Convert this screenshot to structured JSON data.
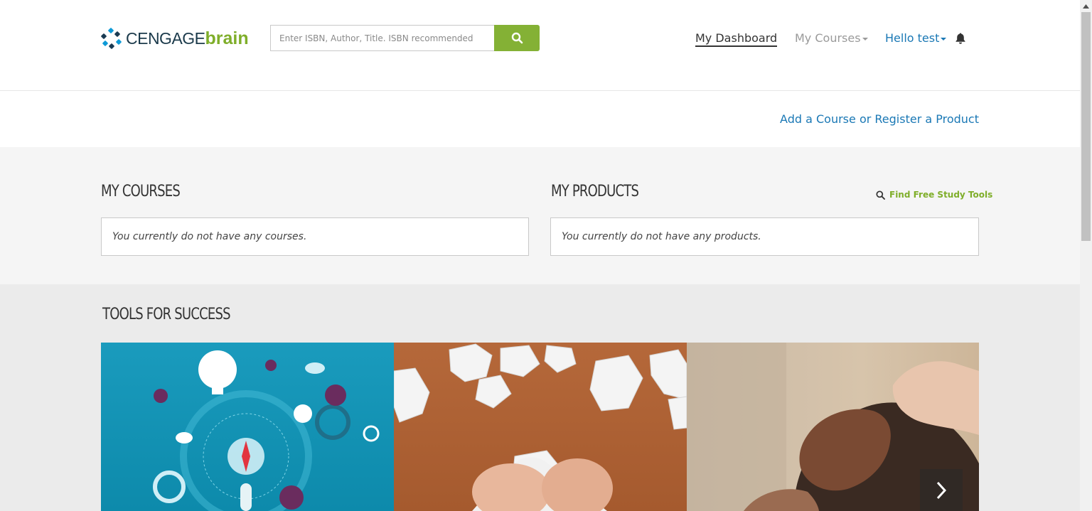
{
  "header": {
    "logo": {
      "word1": "CENGAGE",
      "word2": "brain"
    },
    "search": {
      "placeholder": "Enter ISBN, Author, Title. ISBN recommended",
      "value": ""
    },
    "nav": {
      "dashboard": "My Dashboard",
      "courses": "My Courses",
      "hello": "Hello test"
    },
    "icons": {
      "search": "search-icon",
      "bell": "bell-icon"
    }
  },
  "subbar": {
    "add_course": "Add a Course or Register a Product"
  },
  "dashboard": {
    "courses": {
      "title": "MY COURSES",
      "empty": "You currently do not have any courses."
    },
    "products": {
      "title": "MY PRODUCTS",
      "empty": "You currently do not have any products."
    },
    "find_tools": "Find Free Study Tools"
  },
  "tools": {
    "title": "TOOLS FOR SUCCESS",
    "tiles": [
      {
        "name": "technology-graphic-tile"
      },
      {
        "name": "crumpled-paper-tile"
      },
      {
        "name": "relaxation-tile"
      }
    ]
  },
  "colors": {
    "brand_green": "#84b135",
    "link_blue": "#1a78b5",
    "logo_text": "#1b3a4b"
  }
}
